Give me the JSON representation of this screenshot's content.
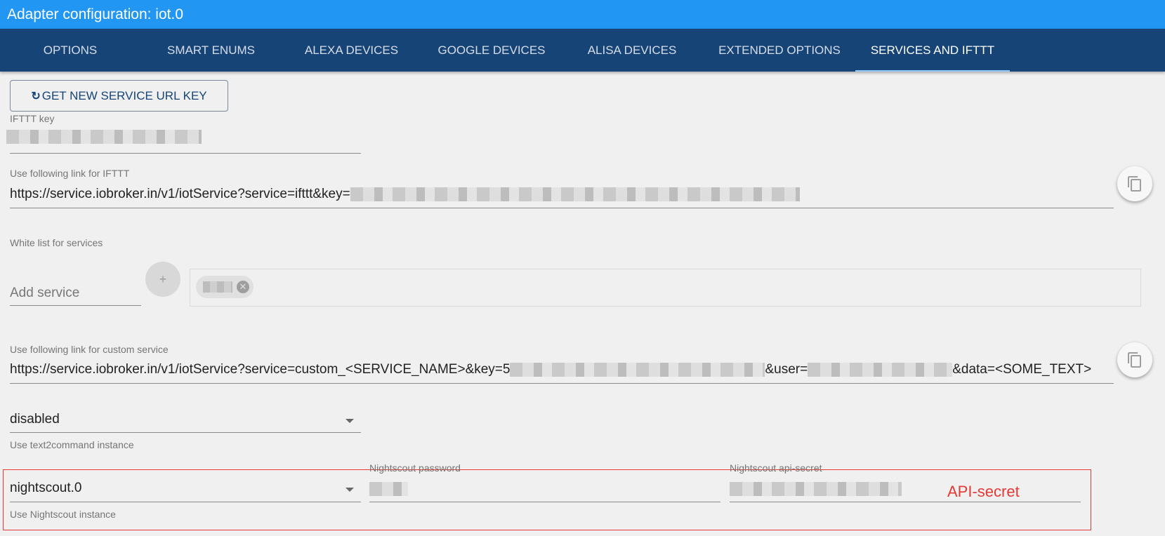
{
  "window": {
    "title": "Adapter configuration: iot.0"
  },
  "tabs": [
    {
      "label": "OPTIONS"
    },
    {
      "label": "SMART ENUMS"
    },
    {
      "label": "ALEXA DEVICES"
    },
    {
      "label": "GOOGLE DEVICES"
    },
    {
      "label": "ALISA DEVICES"
    },
    {
      "label": "EXTENDED OPTIONS"
    },
    {
      "label": "SERVICES AND IFTTT",
      "active": true
    }
  ],
  "service_key_button": {
    "label": "GET NEW SERVICE URL KEY",
    "icon": "refresh-icon"
  },
  "ifttt_key": {
    "label": "IFTTT key",
    "value_redacted": true
  },
  "ifttt_link": {
    "label": "Use following link for IFTTT",
    "value_prefix": "https://service.iobroker.in/v1/iotService?service=ifttt&key=",
    "copy_icon": "copy-icon"
  },
  "white_list": {
    "label": "White list for services",
    "add_placeholder": "Add service",
    "add_button": "+",
    "chips": [
      {
        "redacted": true,
        "delete_icon": "cancel-icon"
      }
    ]
  },
  "custom_link": {
    "label": "Use following link for custom service",
    "part1": "https://service.iobroker.in/v1/iotService?service=custom_<SERVICE_NAME>&key=5",
    "part2": "&user=",
    "part3": "&data=<SOME_TEXT>",
    "copy_icon": "copy-icon"
  },
  "text2command": {
    "value": "disabled",
    "helper": "Use text2command instance"
  },
  "nightscout": {
    "value": "nightscout.0",
    "helper": "Use Nightscout instance",
    "password_label": "Nightscout password",
    "api_secret_label": "Nightscout api-secret"
  },
  "annotation": {
    "text": "API-secret",
    "color": "#e53935"
  },
  "colors": {
    "titlebar": "#2196f3",
    "tabbar": "#164477",
    "accent": "#164477"
  }
}
